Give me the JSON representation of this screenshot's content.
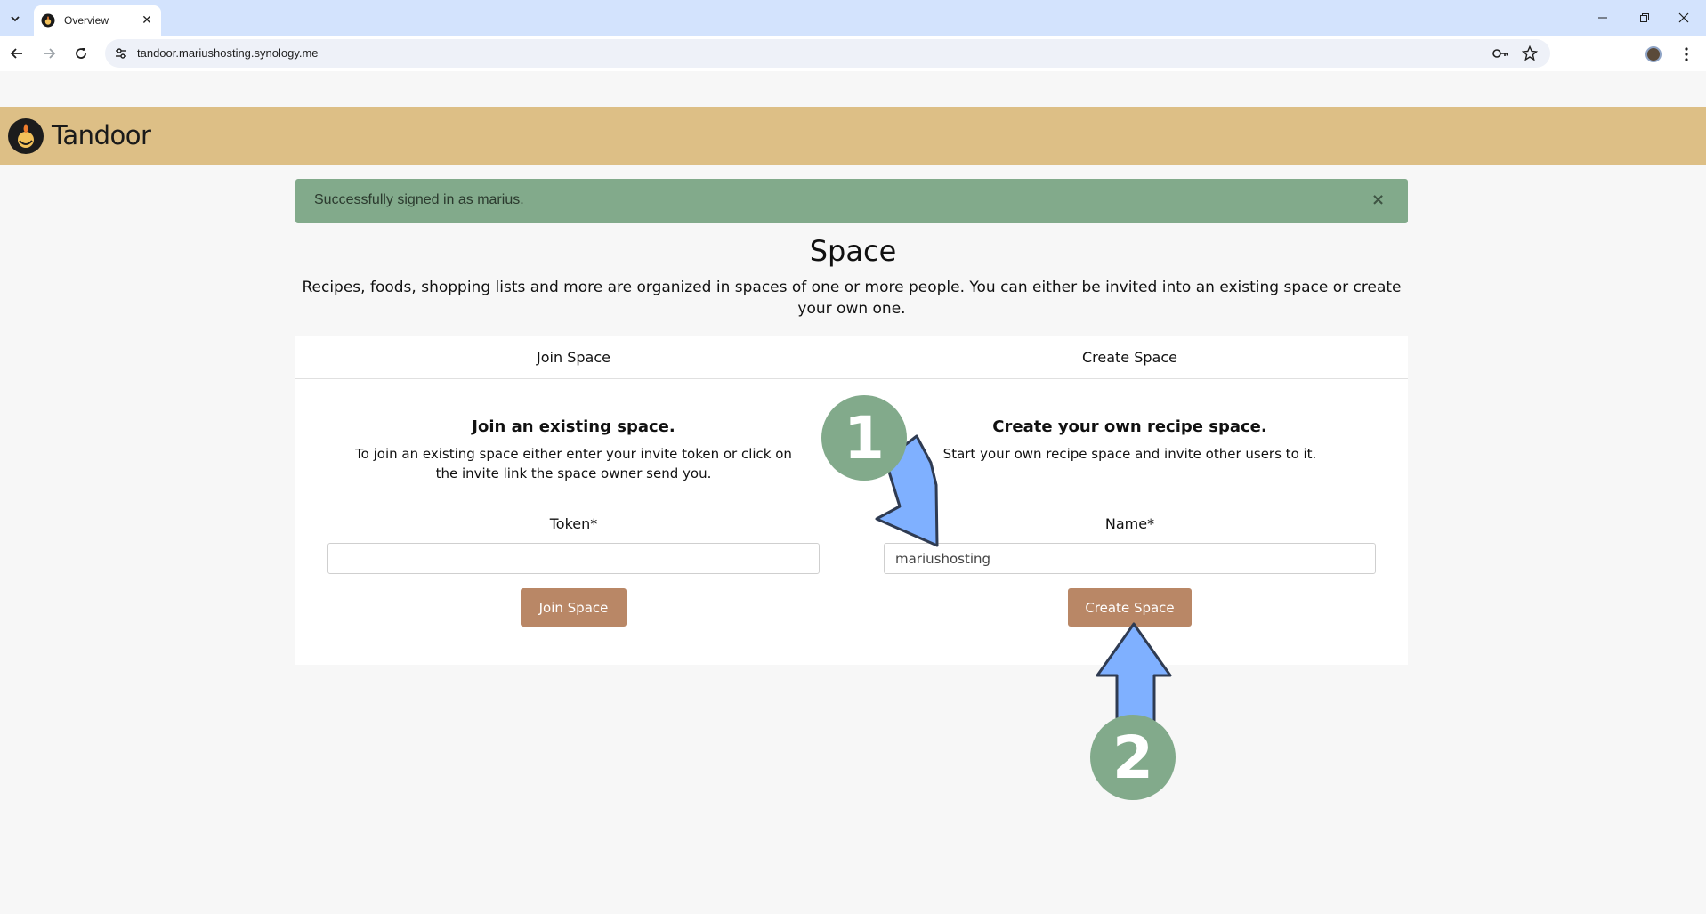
{
  "browser": {
    "tab_title": "Overview",
    "url": "tandoor.mariushosting.synology.me"
  },
  "app": {
    "name": "Tandoor"
  },
  "alert": {
    "message": "Successfully signed in as marius.",
    "close_glyph": "×"
  },
  "page": {
    "title": "Space",
    "lead": "Recipes, foods, shopping lists and more are organized in spaces of one or more people. You can either be invited into an existing space or create your own one."
  },
  "tabs": [
    {
      "label": "Join Space"
    },
    {
      "label": "Create Space"
    }
  ],
  "join": {
    "heading": "Join an existing space.",
    "description": "To join an existing space either enter your invite token or click on the invite link the space owner send you.",
    "field_label": "Token*",
    "field_value": "",
    "button": "Join Space"
  },
  "create": {
    "heading": "Create your own recipe space.",
    "description": "Start your own recipe space and invite other users to it.",
    "field_label": "Name*",
    "field_value": "mariushosting",
    "button": "Create Space"
  },
  "annotations": {
    "step1": "1",
    "step2": "2"
  },
  "colors": {
    "header": "#ddbf86",
    "alert": "#82aa8b",
    "button": "#b98766",
    "arrow": "#7fb0ff",
    "badge": "#82aa8b"
  }
}
